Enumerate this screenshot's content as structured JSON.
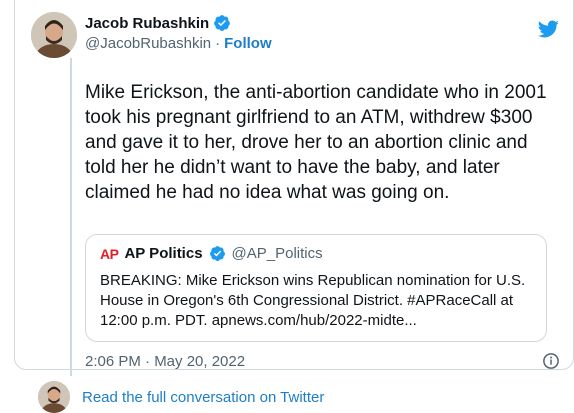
{
  "author": {
    "display_name": "Jacob Rubashkin",
    "handle": "@JacobRubashkin",
    "separator": "·",
    "follow_label": "Follow",
    "verified_icon": "verified-badge-icon",
    "avatar_icon": "profile-avatar"
  },
  "brand": {
    "logo_icon": "twitter-bird-icon",
    "color": "#1d9bf0"
  },
  "tweet": {
    "text": "Mike Erickson, the anti-abortion candidate who in 2001 took his pregnant girlfriend to an ATM, withdrew $300 and gave it to her, drove her to an abortion clinic and told her he didn’t want to have the baby, and later claimed he had no idea what was going on."
  },
  "quoted_tweet": {
    "logo_text": "AP",
    "display_name": "AP Politics",
    "handle": "@AP_Politics",
    "text": "BREAKING: Mike Erickson wins Republican nomination for U.S. House in Oregon's 6th Congressional District. #APRaceCall at 12:00 p.m. PDT. apnews.com/hub/2022-midte...",
    "logo_color": "#e41e26"
  },
  "meta": {
    "timestamp": "2:06 PM · May 20, 2022",
    "info_icon": "info-icon"
  },
  "footer": {
    "read_more_label": "Read the full conversation on Twitter"
  },
  "colors": {
    "link": "#1d7fc7",
    "secondary_text": "#536471",
    "border": "#cfd9de"
  }
}
